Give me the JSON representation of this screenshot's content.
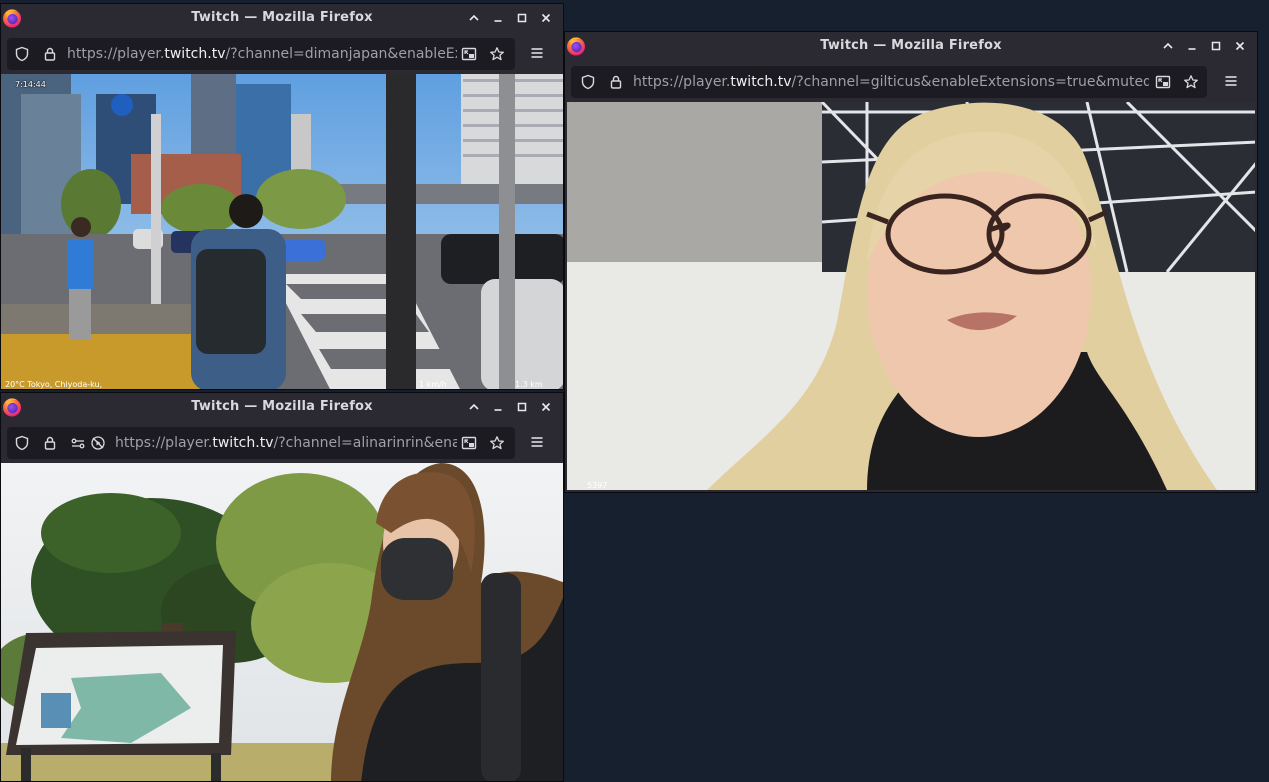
{
  "windows": [
    {
      "id": "dimanjapan",
      "title": "Twitch — Mozilla Firefox",
      "url_prefix": "https://player.",
      "url_domain": "twitch.tv",
      "url_suffix": "/?channel=dimanjapan&enableExten",
      "overlay": {
        "clock": "7:14:44",
        "location": "20°C  Tokyo, Chiyoda-ku,",
        "speed": "1 km/h",
        "distance": "1.3 km"
      }
    },
    {
      "id": "alinarinrin",
      "title": "Twitch — Mozilla Firefox",
      "url_prefix": "https://player.",
      "url_domain": "twitch.tv",
      "url_suffix": "/?channel=alinarinrin&enable"
    },
    {
      "id": "gilticus",
      "title": "Twitch — Mozilla Firefox",
      "url_prefix": "https://player.",
      "url_domain": "twitch.tv",
      "url_suffix": "/?channel=gilticus&enableExtensions=true&muted=false",
      "overlay": {
        "counter": "5397"
      }
    }
  ],
  "icons": {
    "app": "firefox-logo-icon",
    "window_controls": [
      "chevron-up-icon",
      "minimize-icon",
      "maximize-icon",
      "close-icon"
    ],
    "urlbar": [
      "shield-icon",
      "lock-icon",
      "permissions-icon",
      "autoplay-blocked-icon",
      "picture-in-picture-icon",
      "bookmark-star-icon"
    ],
    "menu": "hamburger-menu-icon"
  },
  "colors": {
    "desktop": "#17202f",
    "chrome": "#2b2a33",
    "urlbar": "#1c1b22",
    "firefox_orange": "#ff7139",
    "firefox_purple": "#7b3fe4"
  }
}
